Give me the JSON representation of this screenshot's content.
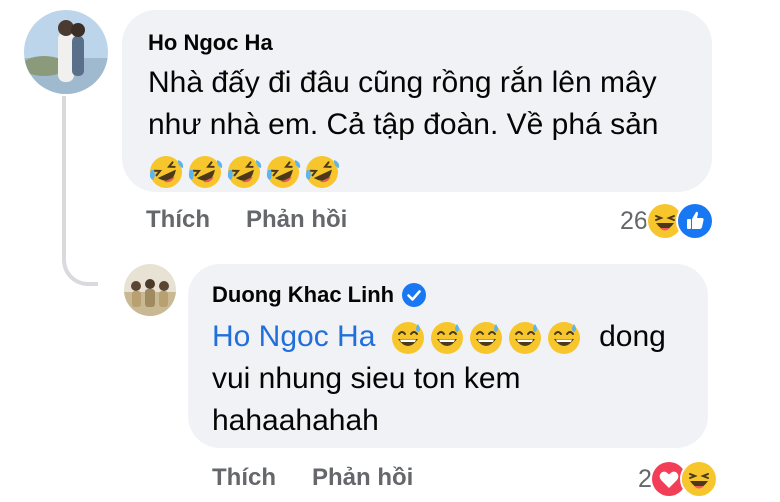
{
  "comments": [
    {
      "author": "Ho Ngoc Ha",
      "text_line1": "Nhà đấy đi đâu cũng rồng rắn lên mây",
      "text_line2": "như nhà em. Cả tập đoàn. Về phá sản",
      "emojis": [
        "rolling-laughing-emoji",
        "rolling-laughing-emoji",
        "rolling-laughing-emoji",
        "rolling-laughing-emoji",
        "rolling-laughing-emoji"
      ],
      "like_label": "Thích",
      "reply_label": "Phản hồi",
      "reaction_count": "26",
      "reaction_icons": [
        "laughing-reaction-icon",
        "like-reaction-icon"
      ]
    },
    {
      "author": "Duong Khac Linh",
      "verified": true,
      "mention": "Ho Ngoc Ha",
      "text_after_emojis": "dong",
      "text_line2": "vui nhung sieu ton kem",
      "text_line3": "hahaahahah",
      "emojis": [
        "grinning-sweat-emoji",
        "grinning-sweat-emoji",
        "grinning-sweat-emoji",
        "grinning-sweat-emoji",
        "grinning-sweat-emoji"
      ],
      "like_label": "Thích",
      "reply_label": "Phản hồi",
      "reaction_count": "2",
      "reaction_icons": [
        "love-reaction-icon",
        "laughing-reaction-icon"
      ]
    }
  ],
  "colors": {
    "bubble": "#f0f2f5",
    "mention": "#216fdb",
    "muted": "#65676b",
    "like_blue": "#1877f2",
    "love_red": "#f33e58",
    "emoji_yellow": "#f7c62d"
  }
}
